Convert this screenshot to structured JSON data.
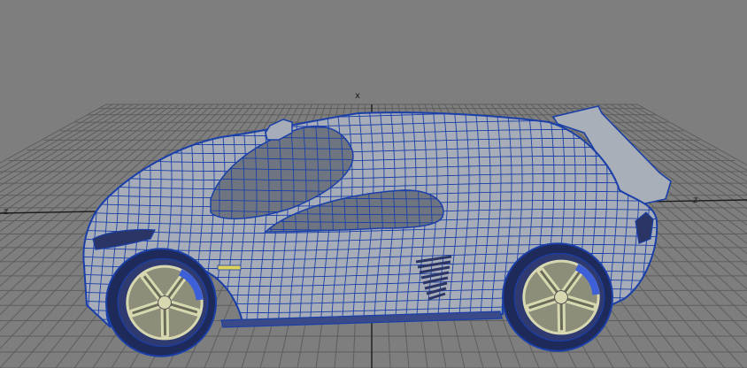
{
  "viewport": {
    "background": "#7e7e7e",
    "grid_color": "#5e5e5e",
    "grid_axis_color": "#1c1c1c",
    "wire_color": "#1a3fa8",
    "shell_color": "#a7adb8",
    "glass_color": "#6f7580",
    "rim_color": "#d8d8b0"
  },
  "axes": {
    "x_label": "x",
    "z_label_left": "z",
    "z_label_right": "z"
  }
}
